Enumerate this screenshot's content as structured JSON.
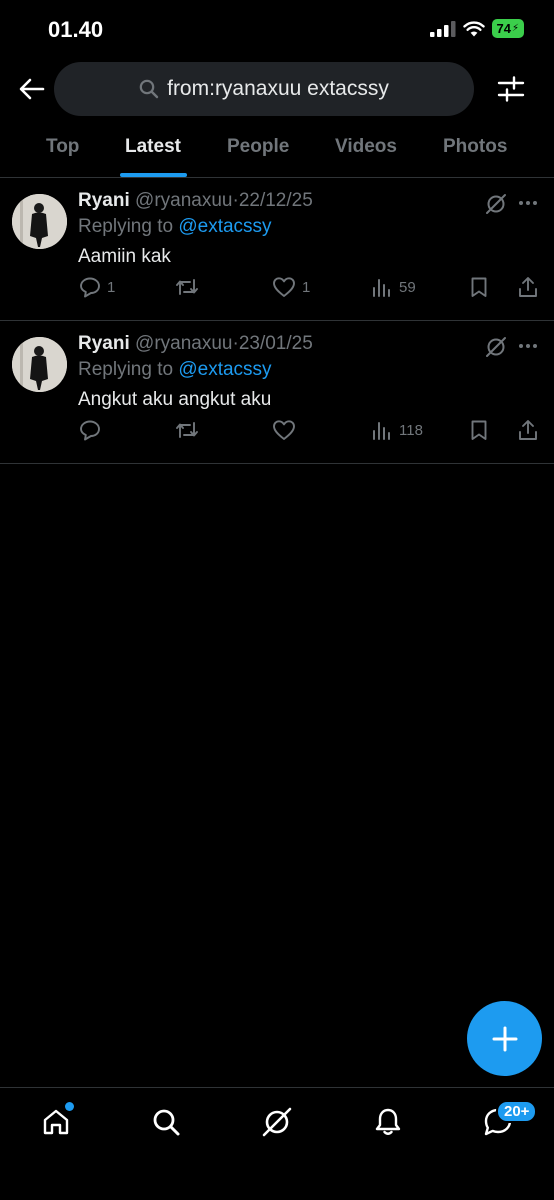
{
  "status_bar": {
    "time": "01.40",
    "battery": "74"
  },
  "search": {
    "value": "from:ryanaxuu extacssy"
  },
  "tabs": [
    {
      "label": "Top"
    },
    {
      "label": "Latest"
    },
    {
      "label": "People"
    },
    {
      "label": "Videos"
    },
    {
      "label": "Photos"
    }
  ],
  "active_tab": "Latest",
  "tweets": [
    {
      "name": "Ryani",
      "handle": "@ryanaxuu",
      "separator": "·",
      "date": "22/12/25",
      "replying_prefix": "Replying to",
      "replying_to": "@extacssy",
      "text": "Aamiin kak",
      "replies": "1",
      "retweets": "",
      "likes": "1",
      "views": "59"
    },
    {
      "name": "Ryani",
      "handle": "@ryanaxuu",
      "separator": "·",
      "date": "23/01/25",
      "replying_prefix": "Replying to",
      "replying_to": "@extacssy",
      "text": "Angkut aku angkut aku",
      "replies": "",
      "retweets": "",
      "likes": "",
      "views": "118"
    }
  ],
  "bottom_nav": {
    "messages_badge": "20+"
  },
  "colors": {
    "accent": "#1d9bf0",
    "background": "#000000",
    "muted": "#71767b",
    "battery": "#3bce4b"
  }
}
